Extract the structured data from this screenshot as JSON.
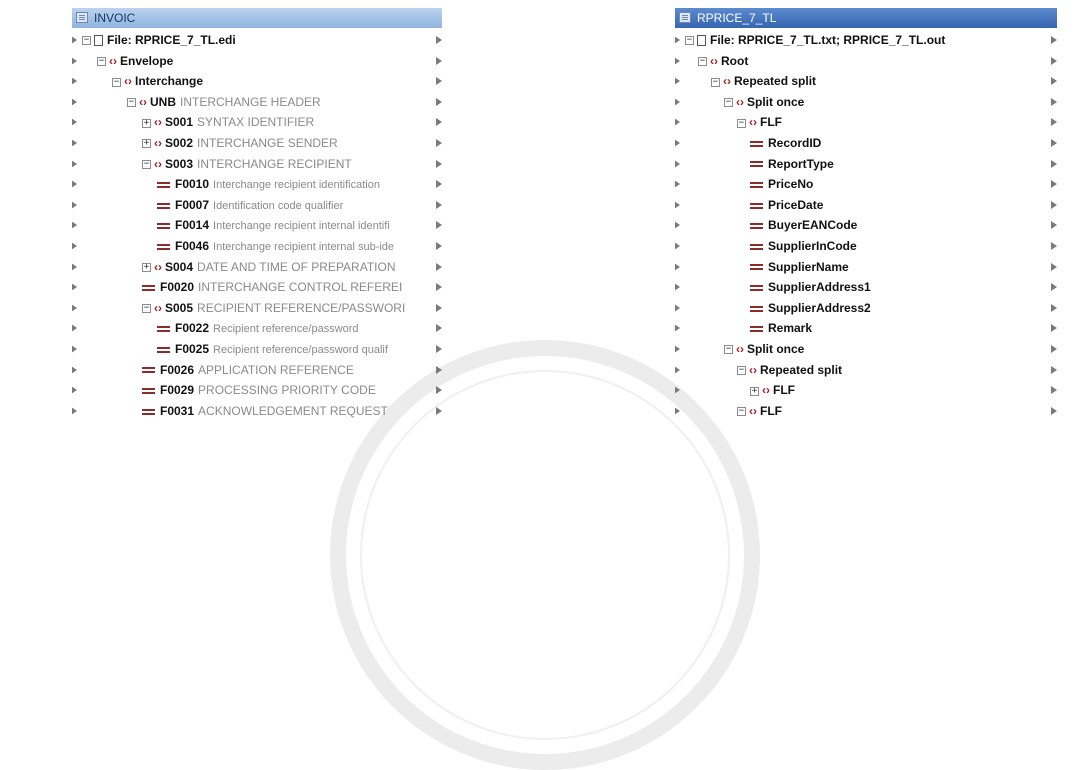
{
  "left_panel": {
    "title": "INVOIC",
    "rows": [
      {
        "expander": "-",
        "icon": "file",
        "name": "File: RPRICE_7_TL.edi",
        "desc": ""
      },
      {
        "expander": "-",
        "icon": "elem",
        "name": "Envelope",
        "desc": ""
      },
      {
        "expander": "-",
        "icon": "elem",
        "name": "Interchange",
        "desc": ""
      },
      {
        "expander": "-",
        "icon": "elem",
        "name": "UNB",
        "desc": "INTERCHANGE HEADER"
      },
      {
        "expander": "+",
        "icon": "elem",
        "name": "S001",
        "desc": "SYNTAX IDENTIFIER"
      },
      {
        "expander": "+",
        "icon": "elem",
        "name": "S002",
        "desc": "INTERCHANGE SENDER"
      },
      {
        "expander": "-",
        "icon": "elem",
        "name": "S003",
        "desc": "INTERCHANGE RECIPIENT"
      },
      {
        "expander": "",
        "icon": "field",
        "name": "F0010",
        "desc": "Interchange recipient identification"
      },
      {
        "expander": "",
        "icon": "field",
        "name": "F0007",
        "desc": "Identification code qualifier"
      },
      {
        "expander": "",
        "icon": "field",
        "name": "F0014",
        "desc": "Interchange recipient internal identifi"
      },
      {
        "expander": "",
        "icon": "field",
        "name": "F0046",
        "desc": "Interchange recipient internal sub-ide"
      },
      {
        "expander": "+",
        "icon": "elem",
        "name": "S004",
        "desc": "DATE AND TIME OF PREPARATION"
      },
      {
        "expander": "",
        "icon": "field",
        "name": "F0020",
        "desc": "INTERCHANGE CONTROL REFEREI"
      },
      {
        "expander": "-",
        "icon": "elem",
        "name": "S005",
        "desc": "RECIPIENT REFERENCE/PASSWORI"
      },
      {
        "expander": "",
        "icon": "field",
        "name": "F0022",
        "desc": "Recipient reference/password"
      },
      {
        "expander": "",
        "icon": "field",
        "name": "F0025",
        "desc": "Recipient reference/password qualif"
      },
      {
        "expander": "",
        "icon": "field",
        "name": "F0026",
        "desc": "APPLICATION REFERENCE"
      },
      {
        "expander": "",
        "icon": "field",
        "name": "F0029",
        "desc": "PROCESSING PRIORITY CODE"
      },
      {
        "expander": "",
        "icon": "field",
        "name": "F0031",
        "desc": "ACKNOWLEDGEMENT REQUEST"
      }
    ]
  },
  "right_panel": {
    "title": "RPRICE_7_TL",
    "rows": [
      {
        "expander": "-",
        "icon": "file",
        "name": "File: RPRICE_7_TL.txt; RPRICE_7_TL.out",
        "desc": ""
      },
      {
        "expander": "-",
        "icon": "elem",
        "name": "Root",
        "desc": ""
      },
      {
        "expander": "-",
        "icon": "elem",
        "name": "Repeated split",
        "desc": ""
      },
      {
        "expander": "-",
        "icon": "elem",
        "name": "Split once",
        "desc": ""
      },
      {
        "expander": "-",
        "icon": "elem",
        "name": "FLF",
        "desc": ""
      },
      {
        "expander": "",
        "icon": "field",
        "name": "RecordID",
        "desc": ""
      },
      {
        "expander": "",
        "icon": "field",
        "name": "ReportType",
        "desc": ""
      },
      {
        "expander": "",
        "icon": "field",
        "name": "PriceNo",
        "desc": ""
      },
      {
        "expander": "",
        "icon": "field",
        "name": "PriceDate",
        "desc": ""
      },
      {
        "expander": "",
        "icon": "field",
        "name": "BuyerEANCode",
        "desc": ""
      },
      {
        "expander": "",
        "icon": "field",
        "name": "SupplierInCode",
        "desc": ""
      },
      {
        "expander": "",
        "icon": "field",
        "name": "SupplierName",
        "desc": ""
      },
      {
        "expander": "",
        "icon": "field",
        "name": "SupplierAddress1",
        "desc": ""
      },
      {
        "expander": "",
        "icon": "field",
        "name": "SupplierAddress2",
        "desc": ""
      },
      {
        "expander": "",
        "icon": "field",
        "name": "Remark",
        "desc": ""
      },
      {
        "expander": "-",
        "icon": "elem",
        "name": "Split once",
        "desc": ""
      },
      {
        "expander": "-",
        "icon": "elem",
        "name": "Repeated split",
        "desc": ""
      },
      {
        "expander": "+",
        "icon": "elem",
        "name": "FLF",
        "desc": ""
      },
      {
        "expander": "-",
        "icon": "elem",
        "name": "FLF",
        "desc": ""
      }
    ]
  },
  "colors": {
    "titlebar_left": "#8fb3e0",
    "titlebar_right": "#3f6fb8",
    "element_icon": "#b01818",
    "field_icon": "#8e2a2a"
  },
  "icons": [
    "file-icon",
    "element-icon",
    "field-icon",
    "expand-icon",
    "collapse-icon",
    "connector-icon"
  ]
}
